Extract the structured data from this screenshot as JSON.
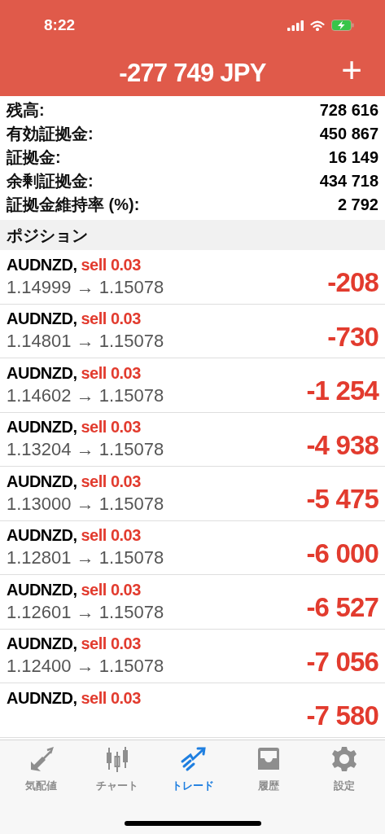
{
  "status_bar": {
    "time": "8:22"
  },
  "header": {
    "title": "-277 749 JPY",
    "add_button": "+"
  },
  "summary": [
    {
      "label": "残高:",
      "value": "728 616"
    },
    {
      "label": "有効証拠金:",
      "value": "450 867"
    },
    {
      "label": "証拠金:",
      "value": "16 149"
    },
    {
      "label": "余剰証拠金:",
      "value": "434 718"
    },
    {
      "label": "証拠金維持率 (%):",
      "value": "2 792"
    }
  ],
  "section_title": "ポジション",
  "positions": [
    {
      "symbol": "AUDNZD,",
      "order": "sell 0.03",
      "prices": "1.14999 → 1.15078",
      "profit": "-208"
    },
    {
      "symbol": "AUDNZD,",
      "order": "sell 0.03",
      "prices": "1.14801 → 1.15078",
      "profit": "-730"
    },
    {
      "symbol": "AUDNZD,",
      "order": "sell 0.03",
      "prices": "1.14602 → 1.15078",
      "profit": "-1 254"
    },
    {
      "symbol": "AUDNZD,",
      "order": "sell 0.03",
      "prices": "1.13204 → 1.15078",
      "profit": "-4 938"
    },
    {
      "symbol": "AUDNZD,",
      "order": "sell 0.03",
      "prices": "1.13000 → 1.15078",
      "profit": "-5 475"
    },
    {
      "symbol": "AUDNZD,",
      "order": "sell 0.03",
      "prices": "1.12801 → 1.15078",
      "profit": "-6 000"
    },
    {
      "symbol": "AUDNZD,",
      "order": "sell 0.03",
      "prices": "1.12601 → 1.15078",
      "profit": "-6 527"
    },
    {
      "symbol": "AUDNZD,",
      "order": "sell 0.03",
      "prices": "1.12400 → 1.15078",
      "profit": "-7 056"
    },
    {
      "symbol": "AUDNZD,",
      "order": "sell 0.03",
      "profit": "-7 580"
    }
  ],
  "tab_bar": [
    {
      "kind": "quotes",
      "label": "気配値",
      "selected": false
    },
    {
      "kind": "chart",
      "label": "チャート",
      "selected": false
    },
    {
      "kind": "trade",
      "label": "トレード",
      "selected": true
    },
    {
      "kind": "history",
      "label": "履歴",
      "selected": false
    },
    {
      "kind": "settings",
      "label": "設定",
      "selected": false
    }
  ]
}
